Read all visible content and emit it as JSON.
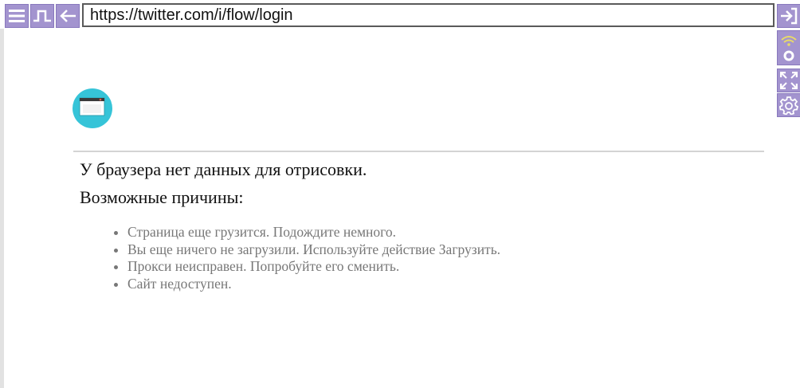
{
  "browser": {
    "url": "https://twitter.com/i/flow/login",
    "accent_color": "#a394cf",
    "toolbar_left": [
      "menu-icon",
      "pulse-icon",
      "back-arrow-icon"
    ],
    "toolbar_right": [
      "login-icon",
      "signal-icon",
      "fullscreen-icon",
      "gear-icon"
    ]
  },
  "content": {
    "logo_color": "#36c4d8",
    "title": "У браузера нет данных для отрисовки.",
    "subtitle": "Возможные причины:",
    "reasons": [
      "Страница еще грузится. Подождите немного.",
      "Вы еще ничего не загрузили. Используйте действие Загрузить.",
      "Прокси неисправен. Попробуйте его сменить.",
      "Сайт недоступен."
    ]
  }
}
